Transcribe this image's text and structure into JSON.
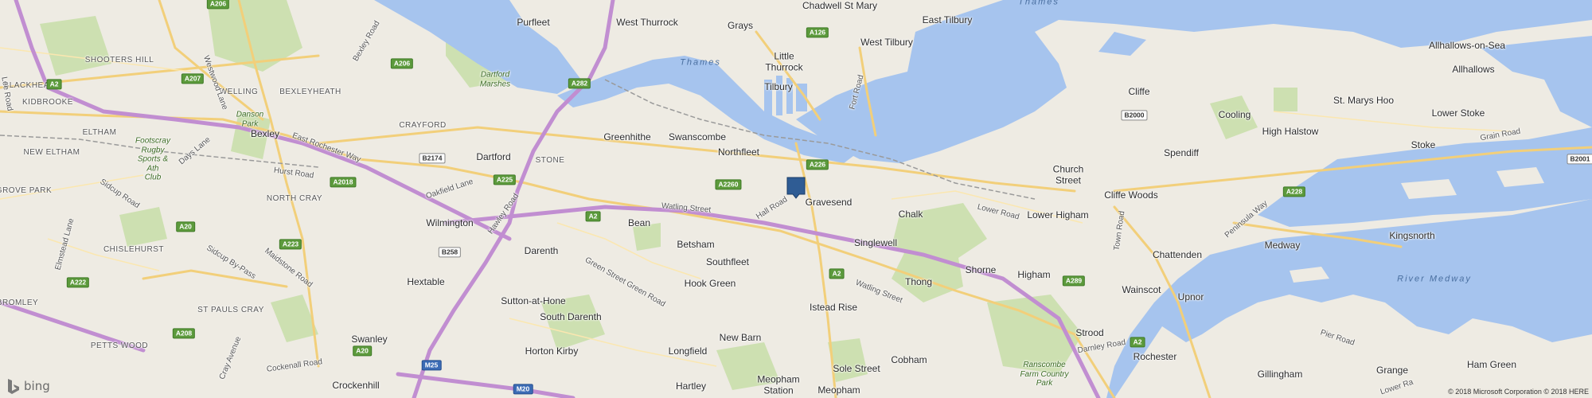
{
  "attribution": {
    "logo": "bing",
    "copyright": "© 2018 Microsoft Corporation © 2018 HERE"
  },
  "marker": {
    "icon": "map-pin-icon",
    "color": "#2f5c94"
  },
  "colors": {
    "land": "#eeebe3",
    "water": "#a6c4ee",
    "park": "#cde0b1",
    "motorway": "#c18ed1",
    "primary": "#f2cf7a"
  },
  "places": {
    "purfleet": "Purfleet",
    "west_thurrock": "West Thurrock",
    "grays": "Grays",
    "chadwell": "Chadwell St Mary",
    "east_tilbury": "East Tilbury",
    "west_tilbury": "West Tilbury",
    "little_thurrock": "Little\nThurrock",
    "tilbury": "Tilbury",
    "allhallows_on_sea": "Allhallows-on-Sea",
    "allhallows": "Allhallows",
    "cliffe": "Cliffe",
    "cooling": "Cooling",
    "st_marys_hoo": "St. Marys Hoo",
    "lower_stoke": "Lower Stoke",
    "high_halstow": "High Halstow",
    "stoke": "Stoke",
    "spendiff": "Spendiff",
    "church_street": "Church\nStreet",
    "cliffe_woods": "Cliffe Woods",
    "blackheath": "BLACKHEATH",
    "shooters_hill": "SHOOTERS HILL",
    "welling": "WELLING",
    "bexleyheath": "BEXLEYHEATH",
    "kidbrooke": "KIDBROOKE",
    "danson_park": "Danson\nPark",
    "crayford": "CRAYFORD",
    "bexley": "Bexley",
    "eltham": "ELTHAM",
    "footscray": "Footscray\nRugby\nSports &\nAth\nClub",
    "new_eltham": "NEW ELTHAM",
    "grove_park": "GROVE PARK",
    "north_cray": "NORTH CRAY",
    "chislehurst": "CHISLEHURST",
    "hextable": "Hextable",
    "wilmington": "Wilmington",
    "dartford": "Dartford",
    "stone": "STONE",
    "greenhithe": "Greenhithe",
    "swanscombe": "Swanscombe",
    "northfleet": "Northfleet",
    "gravesend": "Gravesend",
    "chalk": "Chalk",
    "lower_higham": "Lower Higham",
    "bean": "Bean",
    "darenth": "Darenth",
    "betsham": "Betsham",
    "southfleet": "Southfleet",
    "singlewell": "Singlewell",
    "shorne": "Shorne",
    "thong": "Thong",
    "higham": "Higham",
    "chattenden": "Chattenden",
    "medway": "Medway",
    "kingsnorth": "Kingsnorth",
    "hook_green": "Hook Green",
    "sutton_at_hone": "Sutton-at-Hone",
    "south_darenth": "South Darenth",
    "istead_rise": "Istead Rise",
    "wainscot": "Wainscot",
    "upnor": "Upnor",
    "strood": "Strood",
    "new_barn": "New Barn",
    "horton_kirby": "Horton Kirby",
    "longfield": "Longfield",
    "cobham": "Cobham",
    "sole_street": "Sole Street",
    "rochester": "Rochester",
    "gillingham": "Gillingham",
    "grange": "Grange",
    "ham_green": "Ham Green",
    "bromley": "BROMLEY",
    "st_pauls_cray": "ST PAULS CRAY",
    "petts_wood": "PETTS WOOD",
    "swanley": "Swanley",
    "crockenhill": "Crockenhill",
    "hartley": "Hartley",
    "meopham_station": "Meopham\nStation",
    "meopham": "Meopham",
    "dartford_marshes": "Dartford\nMarshes",
    "ranscombe": "Ranscombe\nFarm Country\nPark"
  },
  "water_labels": {
    "thames_upper": "Thames",
    "thames": "Thames",
    "medway": "River Medway"
  },
  "roads": {
    "east_rochester_way": "East Rochester Way",
    "sidcup_road": "Sidcup Road",
    "sidcup_bypass": "Sidcup By-Pass",
    "watling_street_1": "Watling Street",
    "watling_street_2": "Watling Street",
    "hawley_road": "Hawley Road",
    "oakfield_lane": "Oakfield Lane",
    "hurst_road": "Hurst Road",
    "days_lane": "Days Lane",
    "westwood_lane": "Westwood Lane",
    "lee_road": "Lee Road",
    "elmstead_lane": "Elmstead Lane",
    "maidstone_road": "Maidstone Road",
    "cray_avenue": "Cray Avenue",
    "cockenall_road": "Cockenall Road",
    "bexley_road": "Bexley Road",
    "green_street_green": "Green Street Green Road",
    "hall_road": "Hall Road",
    "fort_road": "Fort Road",
    "lower_road": "Lower Road",
    "town_road": "Town Road",
    "peninsula_way": "Peninsula Way",
    "grain_road": "Grain Road",
    "pier_road": "Pier Road",
    "dartley_road": "Darnley Road",
    "lower_rainham": "Lower Ra"
  },
  "shields": {
    "a206_top": "A206",
    "a207": "A207",
    "a206": "A206",
    "a2_left": "A2",
    "b2174": "B2174",
    "a2018": "A2018",
    "a225": "A225",
    "a20": "A20",
    "a223": "A223",
    "b258": "B258",
    "a222": "A222",
    "a208": "A208",
    "a20_b": "A20",
    "m25": "M25",
    "m20": "M20",
    "a282": "A282",
    "a2260": "A2260",
    "a2_mid": "A2",
    "a226": "A226",
    "a126": "A126",
    "a2_low": "A2",
    "a289": "A289",
    "a2_roch": "A2",
    "b2000": "B2000",
    "a228": "A228",
    "b2001": "B2001"
  }
}
